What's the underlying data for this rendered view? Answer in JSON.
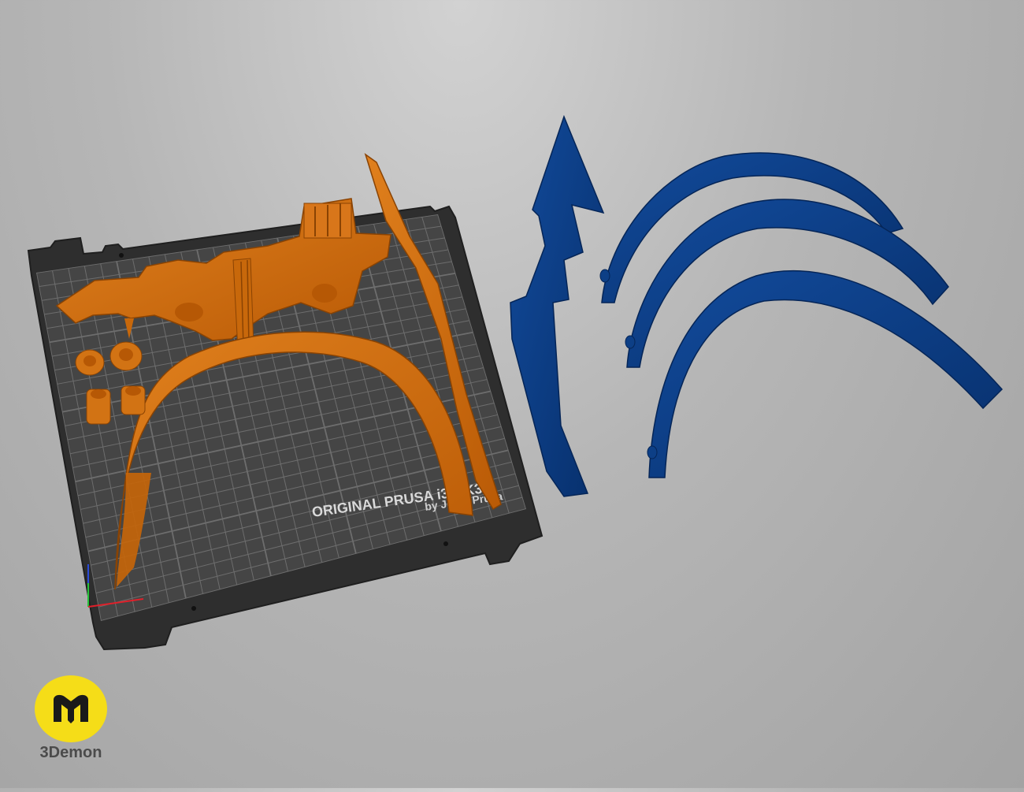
{
  "viewport": {
    "background": "#b3b3b3",
    "bed": {
      "title": "ORIGINAL PRUSA i3 MK3",
      "subtitle": "by Josef Prusa",
      "color": "#3a3a3a",
      "grid_color": "#9a9a9a"
    },
    "parts": {
      "on_bed_color": "#d56f0f",
      "off_bed_color": "#0a3e86",
      "on_bed": [
        "headpiece",
        "headband",
        "spine",
        "ear-cap-1",
        "ear-cap-2",
        "ear-post-1",
        "ear-post-2"
      ],
      "off_bed": [
        "spike-blade",
        "arc-band-1",
        "arc-band-2",
        "arc-band-3"
      ]
    },
    "axes": {
      "x_color": "#e0202a",
      "y_color": "#27c23a",
      "z_color": "#2a4bd8"
    }
  },
  "watermark": {
    "brand": "3Demon",
    "badge_color": "#f5dd18",
    "icon": "m-logo-icon"
  }
}
